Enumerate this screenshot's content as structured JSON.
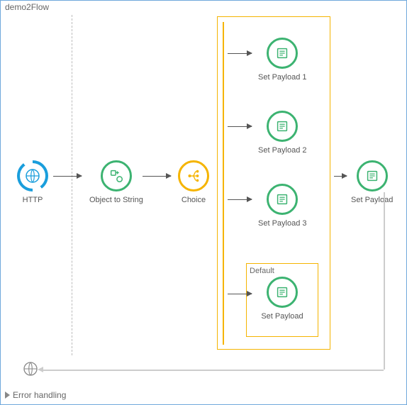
{
  "flow": {
    "title": "demo2Flow",
    "nodes": {
      "http": {
        "label": "HTTP"
      },
      "objToStr": {
        "label": "Object to String"
      },
      "choice": {
        "label": "Choice"
      },
      "sp1": {
        "label": "Set Payload 1"
      },
      "sp2": {
        "label": "Set Payload 2"
      },
      "sp3": {
        "label": "Set Payload 3"
      },
      "spDefault": {
        "label": "Set Payload"
      },
      "spFinal": {
        "label": "Set Payload"
      }
    },
    "defaultBoxLabel": "Default",
    "errorHandling": "Error handling"
  }
}
